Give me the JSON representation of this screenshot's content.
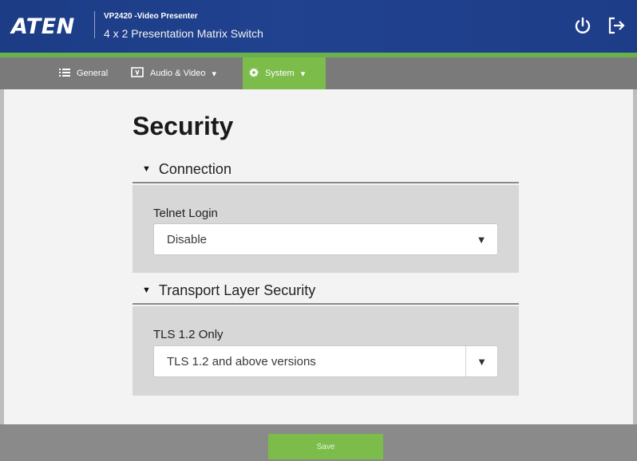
{
  "header": {
    "logo_text": "ATEN",
    "model": "VP2420 -Video Presenter",
    "device_title": "4 x 2 Presentation Matrix Switch",
    "power_icon": "power-icon",
    "logout_icon": "logout-icon"
  },
  "nav": {
    "items": [
      {
        "label": "General",
        "icon": "list-icon"
      },
      {
        "label": "Audio & Video",
        "icon": "av-icon"
      },
      {
        "label": "System",
        "icon": "gear-icon"
      }
    ],
    "dropdown_caret": "▾",
    "active": "System"
  },
  "page": {
    "title": "Security"
  },
  "sections": {
    "connection": {
      "heading": "Connection",
      "field_label": "Telnet Login",
      "value": "Disable"
    },
    "tls": {
      "heading": "Transport Layer Security",
      "field_label": "TLS 1.2 Only",
      "value": "TLS 1.2 and above versions"
    }
  },
  "footer": {
    "save_label": "Save"
  },
  "colors": {
    "header_bg": "#1e3d88",
    "accent_green": "#7cbc4a",
    "nav_bg": "#7a7a7a"
  }
}
